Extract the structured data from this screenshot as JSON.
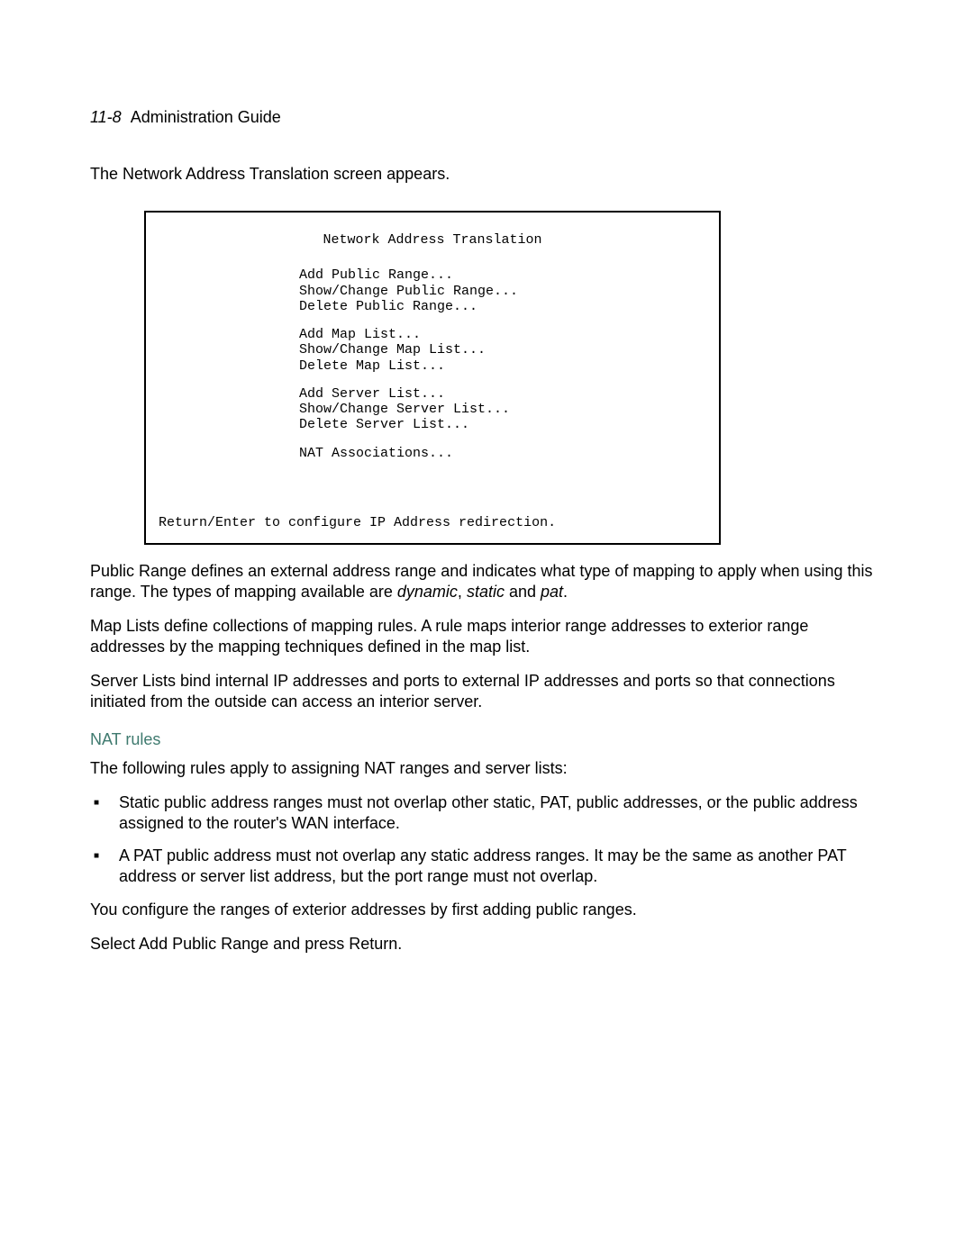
{
  "header": {
    "page_num": "11-8",
    "title": "Administration Guide"
  },
  "intro": "The Network Address Translation screen appears.",
  "terminal": {
    "title": "Network Address Translation",
    "group1": {
      "l1": "Add Public Range...",
      "l2": "Show/Change Public Range...",
      "l3": "Delete Public Range..."
    },
    "group2": {
      "l1": "Add Map List...",
      "l2": "Show/Change Map List...",
      "l3": "Delete Map List..."
    },
    "group3": {
      "l1": "Add Server List...",
      "l2": "Show/Change Server List...",
      "l3": "Delete Server List..."
    },
    "group4": {
      "l1": "NAT Associations..."
    },
    "footer": "Return/Enter to configure IP Address redirection."
  },
  "paragraphs": {
    "public_range_pre": "Public Range deﬁnes an external address range and indicates what type of mapping to apply when using this range. The types of mapping available are ",
    "dynamic": "dynamic",
    "comma_sep": ", ",
    "static": "static",
    "and_sep": " and ",
    "pat": "pat",
    "period": ".",
    "map_lists": "Map Lists deﬁne collections of mapping rules. A rule maps interior range addresses to exterior range addresses by the mapping techniques deﬁned in the map list.",
    "server_lists": "Server Lists bind internal IP addresses and ports to external IP addresses and ports so that connections initiated from the outside can access an interior server."
  },
  "nat_rules": {
    "heading": "NAT rules",
    "intro": "The following rules apply to assigning NAT ranges and server lists:",
    "items": {
      "i0": "Static public address ranges must not overlap other static, PAT, public addresses, or the public address assigned to the router's WAN interface.",
      "i1": "A PAT public address must not overlap any static address ranges. It may be the same as another PAT address or server list address, but the port range must not overlap."
    },
    "after1": "You conﬁgure the ranges of exterior addresses by ﬁrst adding public ranges.",
    "after2_pre": "Select ",
    "after2_bold": "Add Public Range",
    "after2_post": " and press Return."
  }
}
